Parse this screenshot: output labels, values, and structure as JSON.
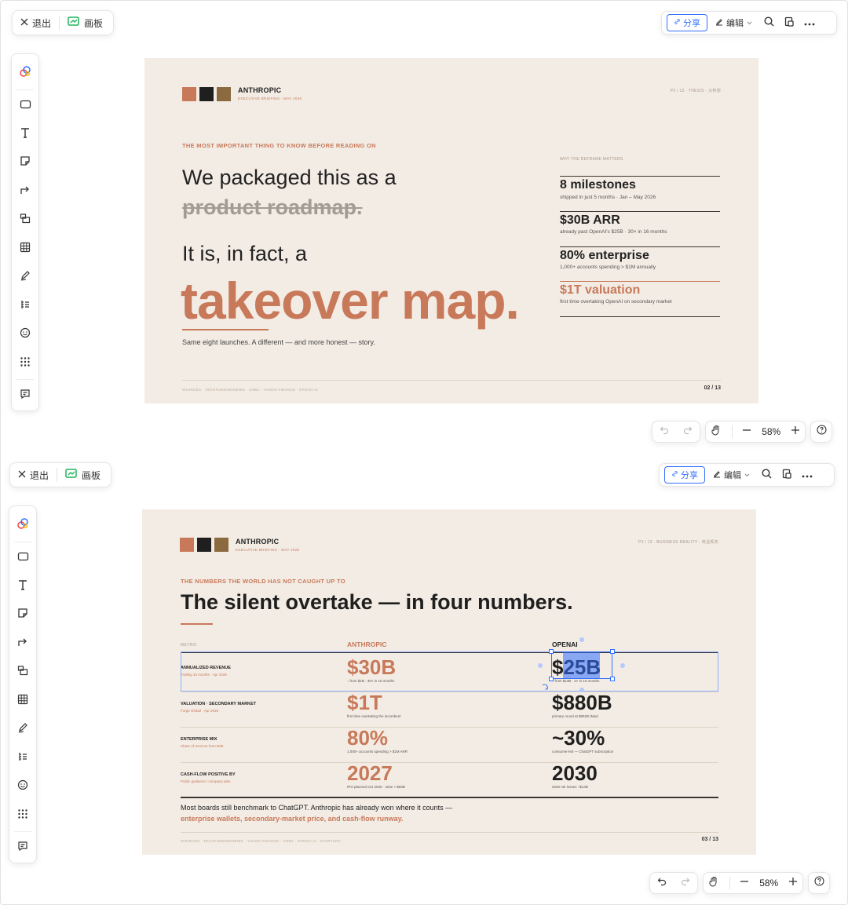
{
  "top": {
    "exit_label": "退出",
    "board_label": "画板",
    "share_label": "分享",
    "edit_label": "编辑",
    "zoom": "58%",
    "slide": {
      "brand": "ANTHROPIC",
      "brand_sub": "EXECUTIVE BRIEFING · MAY 2026",
      "running_head": "P2 / 13 · THESIS · 大构想",
      "kicker": "THE MOST IMPORTANT THING TO KNOW BEFORE READING ON",
      "line1": "We packaged this as a",
      "struck": "product roadmap.",
      "line2": "It is, in fact, a",
      "hero": "takeover map.",
      "caption": "Same eight launches. A different — and more honest — story.",
      "side_label": "WHY THE REFRAME MATTERS",
      "milestones": [
        {
          "title": "8 milestones",
          "sub": "shipped in just 5 months · Jan – May 2026"
        },
        {
          "title": "$30B ARR",
          "sub": "already past OpenAI's $25B · 30× in 16 months"
        },
        {
          "title": "80% enterprise",
          "sub": "1,000+ accounts spending > $1M annually"
        },
        {
          "title": "$1T valuation",
          "sub": "first time overtaking OpenAI on secondary market"
        }
      ],
      "sources": "SOURCES · TECHFUNDINGNEWS · CNBC · YAHOO FINANCE · EPOCH AI",
      "page": "02 / 13"
    }
  },
  "bottom": {
    "exit_label": "退出",
    "board_label": "画板",
    "share_label": "分享",
    "edit_label": "编辑",
    "zoom": "58%",
    "slide": {
      "brand": "ANTHROPIC",
      "brand_sub": "EXECUTIVE BRIEFING · MAY 2026",
      "running_head": "P3 / 13 · BUSINESS REALITY · 商业现实",
      "kicker": "THE NUMBERS THE WORLD HAS NOT CAUGHT UP TO",
      "title": "The silent overtake — in four numbers.",
      "col_metric": "METRIC",
      "col_a": "ANTHROPIC",
      "col_b": "OPENAI",
      "rows": [
        {
          "metric": "ANNUALIZED REVENUE",
          "metric_sub": "Trailing 16 months · Apr 2026",
          "a": "$30B",
          "a_sub": "↑ from $1B · 30× in 16 months",
          "b": "$25B",
          "b_sub": "↑ from $13B · 2× in 16 months"
        },
        {
          "metric": "VALUATION · SECONDARY MARKET",
          "metric_sub": "Forge Global · Apr 2026",
          "a": "$1T",
          "a_sub": "first time overtaking the incumbent",
          "b": "$880B",
          "b_sub": "primary round at $852B (Mar)"
        },
        {
          "metric": "ENTERPRISE MIX",
          "metric_sub": "Share of revenue from B2B",
          "a": "80%",
          "a_sub": "1,000+ accounts spending > $1M ARR",
          "b": "~30%",
          "b_sub": "consumer-led — ChatGPT subscription"
        },
        {
          "metric": "CASH-FLOW POSITIVE BY",
          "metric_sub": "Public guidance / company plan",
          "a": "2027",
          "a_sub": "IPO planned Oct 2026 · raise > $60B",
          "b": "2030",
          "b_sub": "2026 net losses ~$14B"
        }
      ],
      "note_line1": "Most boards still benchmark to ChatGPT. Anthropic has already won where it counts —",
      "note_line2": "enterprise wallets, secondary-market price, and cash-flow runway.",
      "sources": "SOURCES · TECHFUNDINGNEWS · YAHOO FINANCE · CNBC · EPOCH AI · STARTUPS",
      "page": "03 / 13"
    }
  },
  "colors": {
    "accent": "#c8795a",
    "sq1": "#c8795a",
    "sq2": "#1f1f1f",
    "sq3": "#8a6a3e",
    "slide_bg": "#f3ece4",
    "selection": "#3370ff"
  }
}
